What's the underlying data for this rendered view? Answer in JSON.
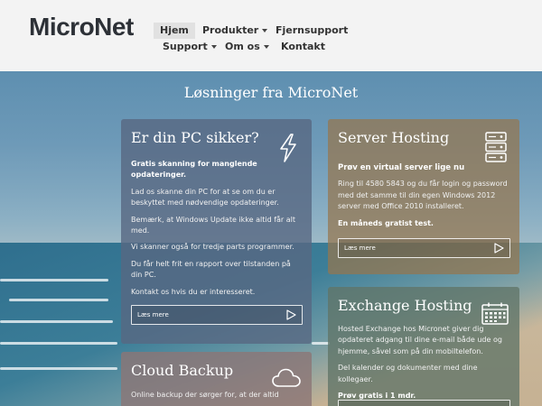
{
  "header": {
    "logo": "MicroNet",
    "nav": [
      {
        "label": "Hjem",
        "active": true,
        "dropdown": false
      },
      {
        "label": "Produkter",
        "active": false,
        "dropdown": true
      },
      {
        "label": "Fjernsupport",
        "active": false,
        "dropdown": false
      },
      {
        "label": "Support",
        "active": false,
        "dropdown": true
      },
      {
        "label": "Om os",
        "active": false,
        "dropdown": true
      },
      {
        "label": "Kontakt",
        "active": false,
        "dropdown": false
      }
    ]
  },
  "hero": {
    "title": "Løsninger fra MicroNet"
  },
  "cards": {
    "pc": {
      "title": "Er din PC sikker?",
      "icon": "lightning-icon",
      "lead": "Gratis skanning for manglende opdateringer.",
      "p1": "Lad os skanne din PC for at se om du er beskyttet med nødvendige opdateringer.",
      "p2": "Bemærk, at Windows Update ikke altid får alt med.",
      "p3": "Vi skanner også for tredje parts programmer.",
      "p4": "Du får helt frit en rapport over tilstanden på din PC.",
      "p5": "Kontakt os hvis du er interesseret.",
      "button": "Læs mere"
    },
    "server": {
      "title": "Server Hosting",
      "icon": "server-icon",
      "lead": "Prøv en virtual server lige nu",
      "p1": "Ring til 4580 5843 og du får login og password med det samme til din egen Windows 2012 server med Office 2010 installeret.",
      "p2": "En måneds gratist test.",
      "button": "Læs mere"
    },
    "exchange": {
      "title": "Exchange Hosting",
      "icon": "calendar-icon",
      "p1": "Hosted Exchange hos Micronet giver dig opdateret adgang til dine e-mail både ude og hjemme, såvel som på din mobiltelefon.",
      "p2": "Del kalender og dokumenter med dine kollegaer.",
      "p3": "Prøv gratis i 1 mdr."
    },
    "backup": {
      "title": "Cloud Backup",
      "icon": "cloud-icon",
      "p1": "Online backup der sørger for, at der altid"
    }
  },
  "colors": {
    "header_bg": "#f3f3f3",
    "logo": "#2d3137",
    "card_dark": "#586882",
    "card_brown": "#96764e",
    "card_green": "#607468"
  }
}
